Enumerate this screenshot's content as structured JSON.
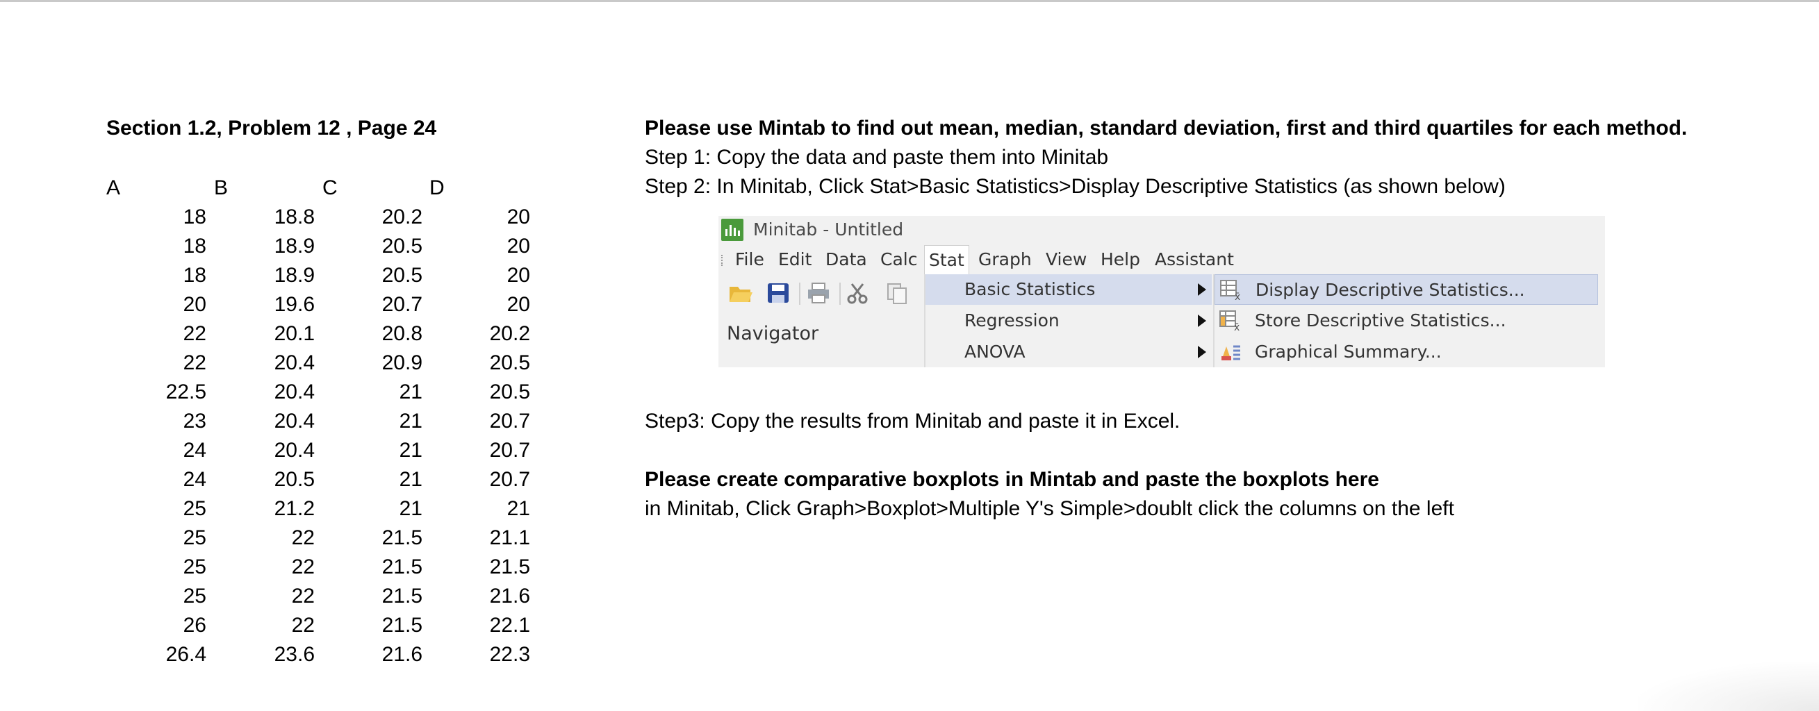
{
  "section_title": "Section 1.2, Problem 12 , Page 24",
  "table": {
    "headers": [
      "A",
      "B",
      "C",
      "D"
    ],
    "columns": [
      [
        "18",
        "18",
        "18",
        "20",
        "22",
        "22",
        "22.5",
        "23",
        "24",
        "24",
        "25",
        "25",
        "25",
        "25",
        "26",
        "26.4"
      ],
      [
        "18.8",
        "18.9",
        "18.9",
        "19.6",
        "20.1",
        "20.4",
        "20.4",
        "20.4",
        "20.4",
        "20.5",
        "21.2",
        "22",
        "22",
        "22",
        "22",
        "23.6"
      ],
      [
        "20.2",
        "20.5",
        "20.5",
        "20.7",
        "20.8",
        "20.9",
        "21",
        "21",
        "21",
        "21",
        "21",
        "21.5",
        "21.5",
        "21.5",
        "21.5",
        "21.6"
      ],
      [
        "20",
        "20",
        "20",
        "20",
        "20.2",
        "20.5",
        "20.5",
        "20.7",
        "20.7",
        "20.7",
        "21",
        "21.1",
        "21.5",
        "21.6",
        "22.1",
        "22.3"
      ]
    ]
  },
  "instructions": {
    "heading": "Please use Mintab to find out mean, median, standard deviation, first and third quartiles for each method.",
    "step1": "Step 1: Copy the data and paste them into Minitab",
    "step2": "Step 2: In Minitab, Click Stat>Basic Statistics>Display Descriptive Statistics (as shown below)",
    "step3": "Step3: Copy the results from Minitab and paste it in Excel.",
    "boxplot_heading": "Please create comparative boxplots in Mintab and paste the boxplots here",
    "boxplot_step": "in Minitab, Click Graph>Boxplot>Multiple Y's Simple>doublt click the columns on the left"
  },
  "minitab": {
    "title": "Minitab - Untitled",
    "menus": [
      "File",
      "Edit",
      "Data",
      "Calc",
      "Stat",
      "Graph",
      "View",
      "Help",
      "Assistant"
    ],
    "active_menu": "Stat",
    "navigator": "Navigator",
    "stat_menu_items": [
      "Basic Statistics",
      "Regression",
      "ANOVA"
    ],
    "basic_stats_items": [
      "Display Descriptive Statistics...",
      "Store Descriptive Statistics...",
      "Graphical Summary..."
    ],
    "highlight_color": "#d5dced",
    "logo_color": "#4a9a3b"
  }
}
